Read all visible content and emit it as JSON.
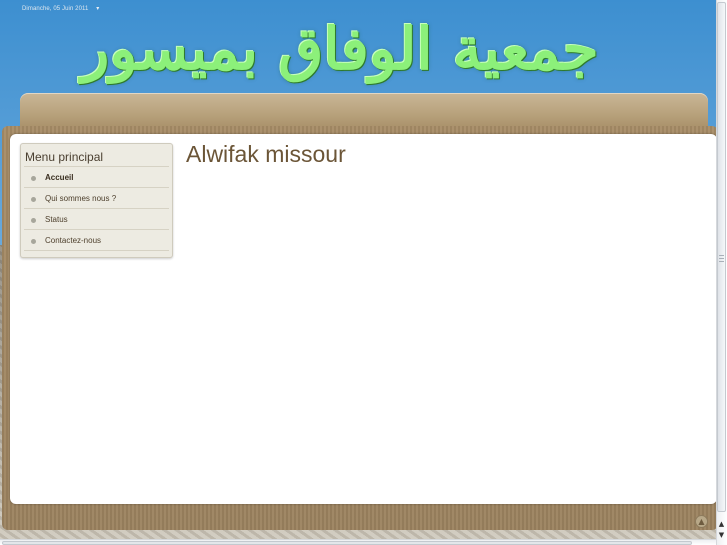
{
  "header": {
    "date_text": "Dimanche, 05 Juin 2011",
    "date_icon": "small-arrow-icon",
    "banner_title": "جمعية الوفاق بميسور"
  },
  "sidebar": {
    "title": "Menu principal",
    "items": [
      {
        "label": "Accueil",
        "active": true
      },
      {
        "label": "Qui sommes nous ?",
        "active": false
      },
      {
        "label": "Status",
        "active": false
      },
      {
        "label": "Contactez-nous",
        "active": false
      }
    ]
  },
  "main": {
    "page_title": "Alwifak missour"
  },
  "footer": {
    "back_to_top_icon": "back-to-top-icon"
  },
  "colors": {
    "banner_text": "#8cf07a",
    "title_text": "#6b5537",
    "frame": "#a88d67",
    "menu_bg": "#edebe2"
  }
}
